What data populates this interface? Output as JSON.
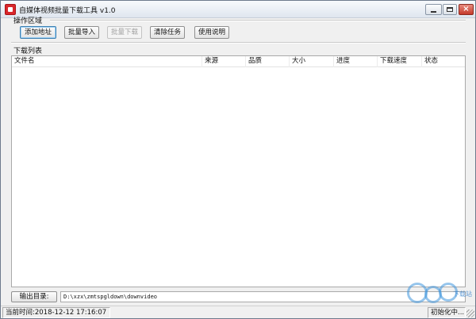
{
  "window": {
    "title": "自媒体视频批量下载工具 v1.0"
  },
  "operations": {
    "label": "操作区域",
    "buttons": {
      "add_url": "添加地址",
      "batch_import": "批量导入",
      "batch_download": "批量下载",
      "clear_tasks": "清除任务",
      "help": "使用说明"
    }
  },
  "downloads": {
    "label": "下载列表",
    "columns": [
      "文件名",
      "来源",
      "品质",
      "大小",
      "进度",
      "下载速度",
      "状态"
    ],
    "rows": []
  },
  "output": {
    "button_label": "输出目录:",
    "path": "D:\\xzx\\zmtspgldown\\downvideo"
  },
  "statusbar": {
    "time": "当前时间:2018-12-12 17:16:07",
    "status": "初始化中..."
  },
  "watermark": {
    "text": "下载站"
  },
  "colors": {
    "close_button": "#c4392b",
    "active_button_border": "#3c7fb1",
    "app_icon": "#d8262b"
  }
}
